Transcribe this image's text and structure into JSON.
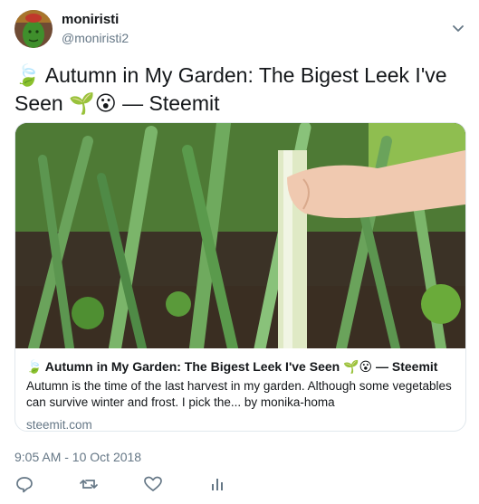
{
  "author": {
    "name": "moniristi",
    "handle": "@moniristi2"
  },
  "tweet": {
    "text": "🍃 Autumn in My Garden: The Bigest Leek I've Seen 🌱😮 — Steemit",
    "timestamp": "9:05 AM - 10 Oct 2018"
  },
  "card": {
    "title": "🍃 Autumn in My Garden: The Bigest Leek I've Seen 🌱😮 — Steemit",
    "description": "Autumn is the time of the last harvest in my garden. Although some vegetables can survive winter and frost. I pick the... by monika-homa",
    "domain": "steemit.com"
  },
  "actions": {
    "reply_icon": "reply-icon",
    "retweet_icon": "retweet-icon",
    "like_icon": "like-icon",
    "analytics_icon": "analytics-icon"
  },
  "colors": {
    "secondary_text": "#657786",
    "border": "#e1e8ed",
    "leek_green": "#5a8f3a"
  }
}
